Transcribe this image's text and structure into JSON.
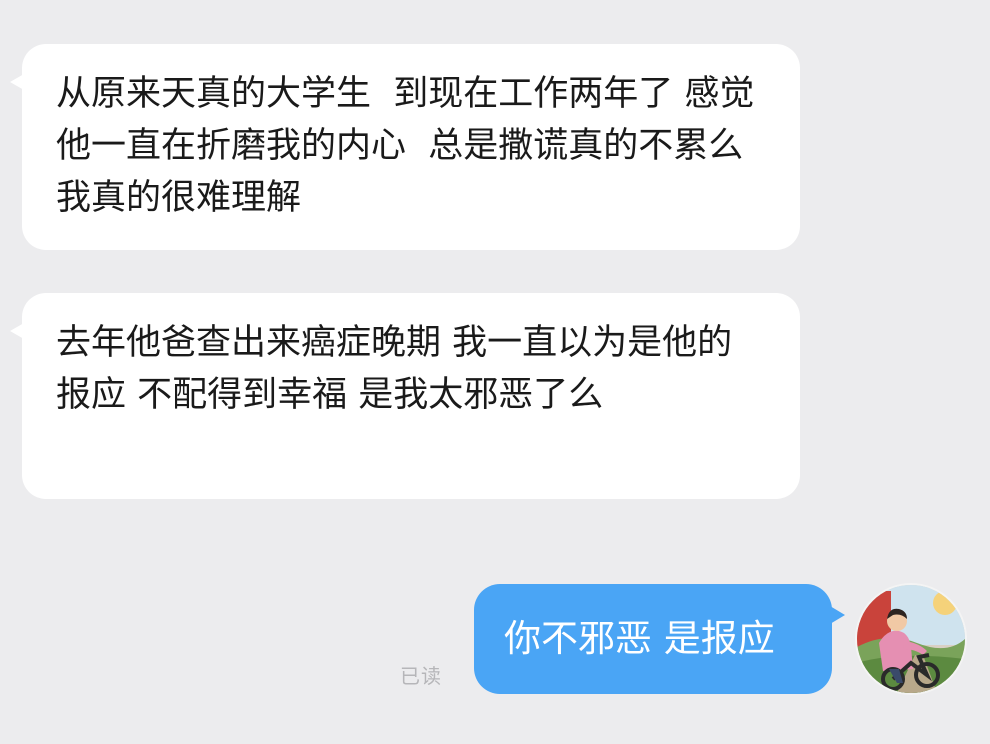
{
  "conversation": {
    "messages": [
      {
        "side": "incoming",
        "text": "从原来天真的大学生  到现在工作两年了 感觉他一直在折磨我的内心  总是撒谎真的不累么  我真的很难理解"
      },
      {
        "side": "incoming",
        "text": "去年他爸查出来癌症晚期 我一直以为是他的报应 不配得到幸福 是我太邪恶了么"
      },
      {
        "side": "outgoing",
        "text": "你不邪恶 是报应",
        "status": "已读"
      }
    ]
  },
  "avatar": {
    "icon": "user-avatar-illustration"
  },
  "colors": {
    "background": "#ececee",
    "incoming_bubble": "#ffffff",
    "outgoing_bubble": "#4aa5f5",
    "read_status": "#b6b6b9"
  }
}
